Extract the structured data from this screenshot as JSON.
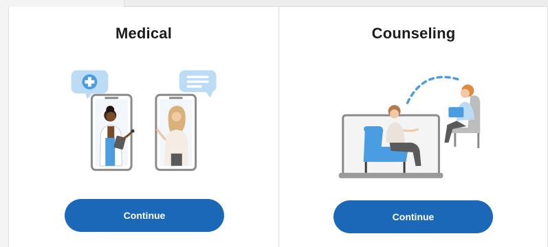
{
  "cards": [
    {
      "title": "Medical",
      "illustration": "doctor-patient-video-call-illustration",
      "button_label": "Continue"
    },
    {
      "title": "Counseling",
      "illustration": "therapist-client-video-session-illustration",
      "button_label": "Continue"
    }
  ],
  "colors": {
    "accent": "#1c68b8",
    "illustration_blue": "#4a9de0",
    "illustration_light_blue": "#bcdcf5",
    "card_background": "#ffffff",
    "page_background": "#f3f3f3"
  }
}
